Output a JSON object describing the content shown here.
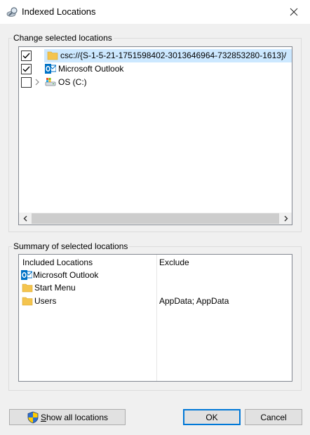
{
  "window": {
    "title": "Indexed Locations"
  },
  "change_group": {
    "legend": "Change selected locations",
    "tree": [
      {
        "label": "csc://{S-1-5-21-1751598402-3013646964-732853280-1613}/",
        "checked": true,
        "icon": "folder-icon",
        "selected": true
      },
      {
        "label": "Microsoft Outlook",
        "checked": true,
        "icon": "outlook-icon",
        "selected": false
      },
      {
        "label": "OS (C:)",
        "checked": false,
        "icon": "drive-icon",
        "selected": false,
        "expandable": true
      }
    ]
  },
  "summary_group": {
    "legend": "Summary of selected locations",
    "columns": {
      "included": "Included Locations",
      "exclude": "Exclude"
    },
    "rows": [
      {
        "label": "Microsoft Outlook",
        "icon": "outlook-icon",
        "exclude": ""
      },
      {
        "label": "Start Menu",
        "icon": "folder-icon",
        "exclude": ""
      },
      {
        "label": "Users",
        "icon": "folder-icon",
        "exclude": "AppData; AppData"
      }
    ]
  },
  "buttons": {
    "show_all_first": "S",
    "show_all_rest": "how all locations",
    "ok": "OK",
    "cancel": "Cancel"
  },
  "colors": {
    "selection": "#cce8ff",
    "default_border": "#0078d7",
    "outlook_blue": "#0072c6",
    "folder_yellow": "#f4c44e"
  }
}
